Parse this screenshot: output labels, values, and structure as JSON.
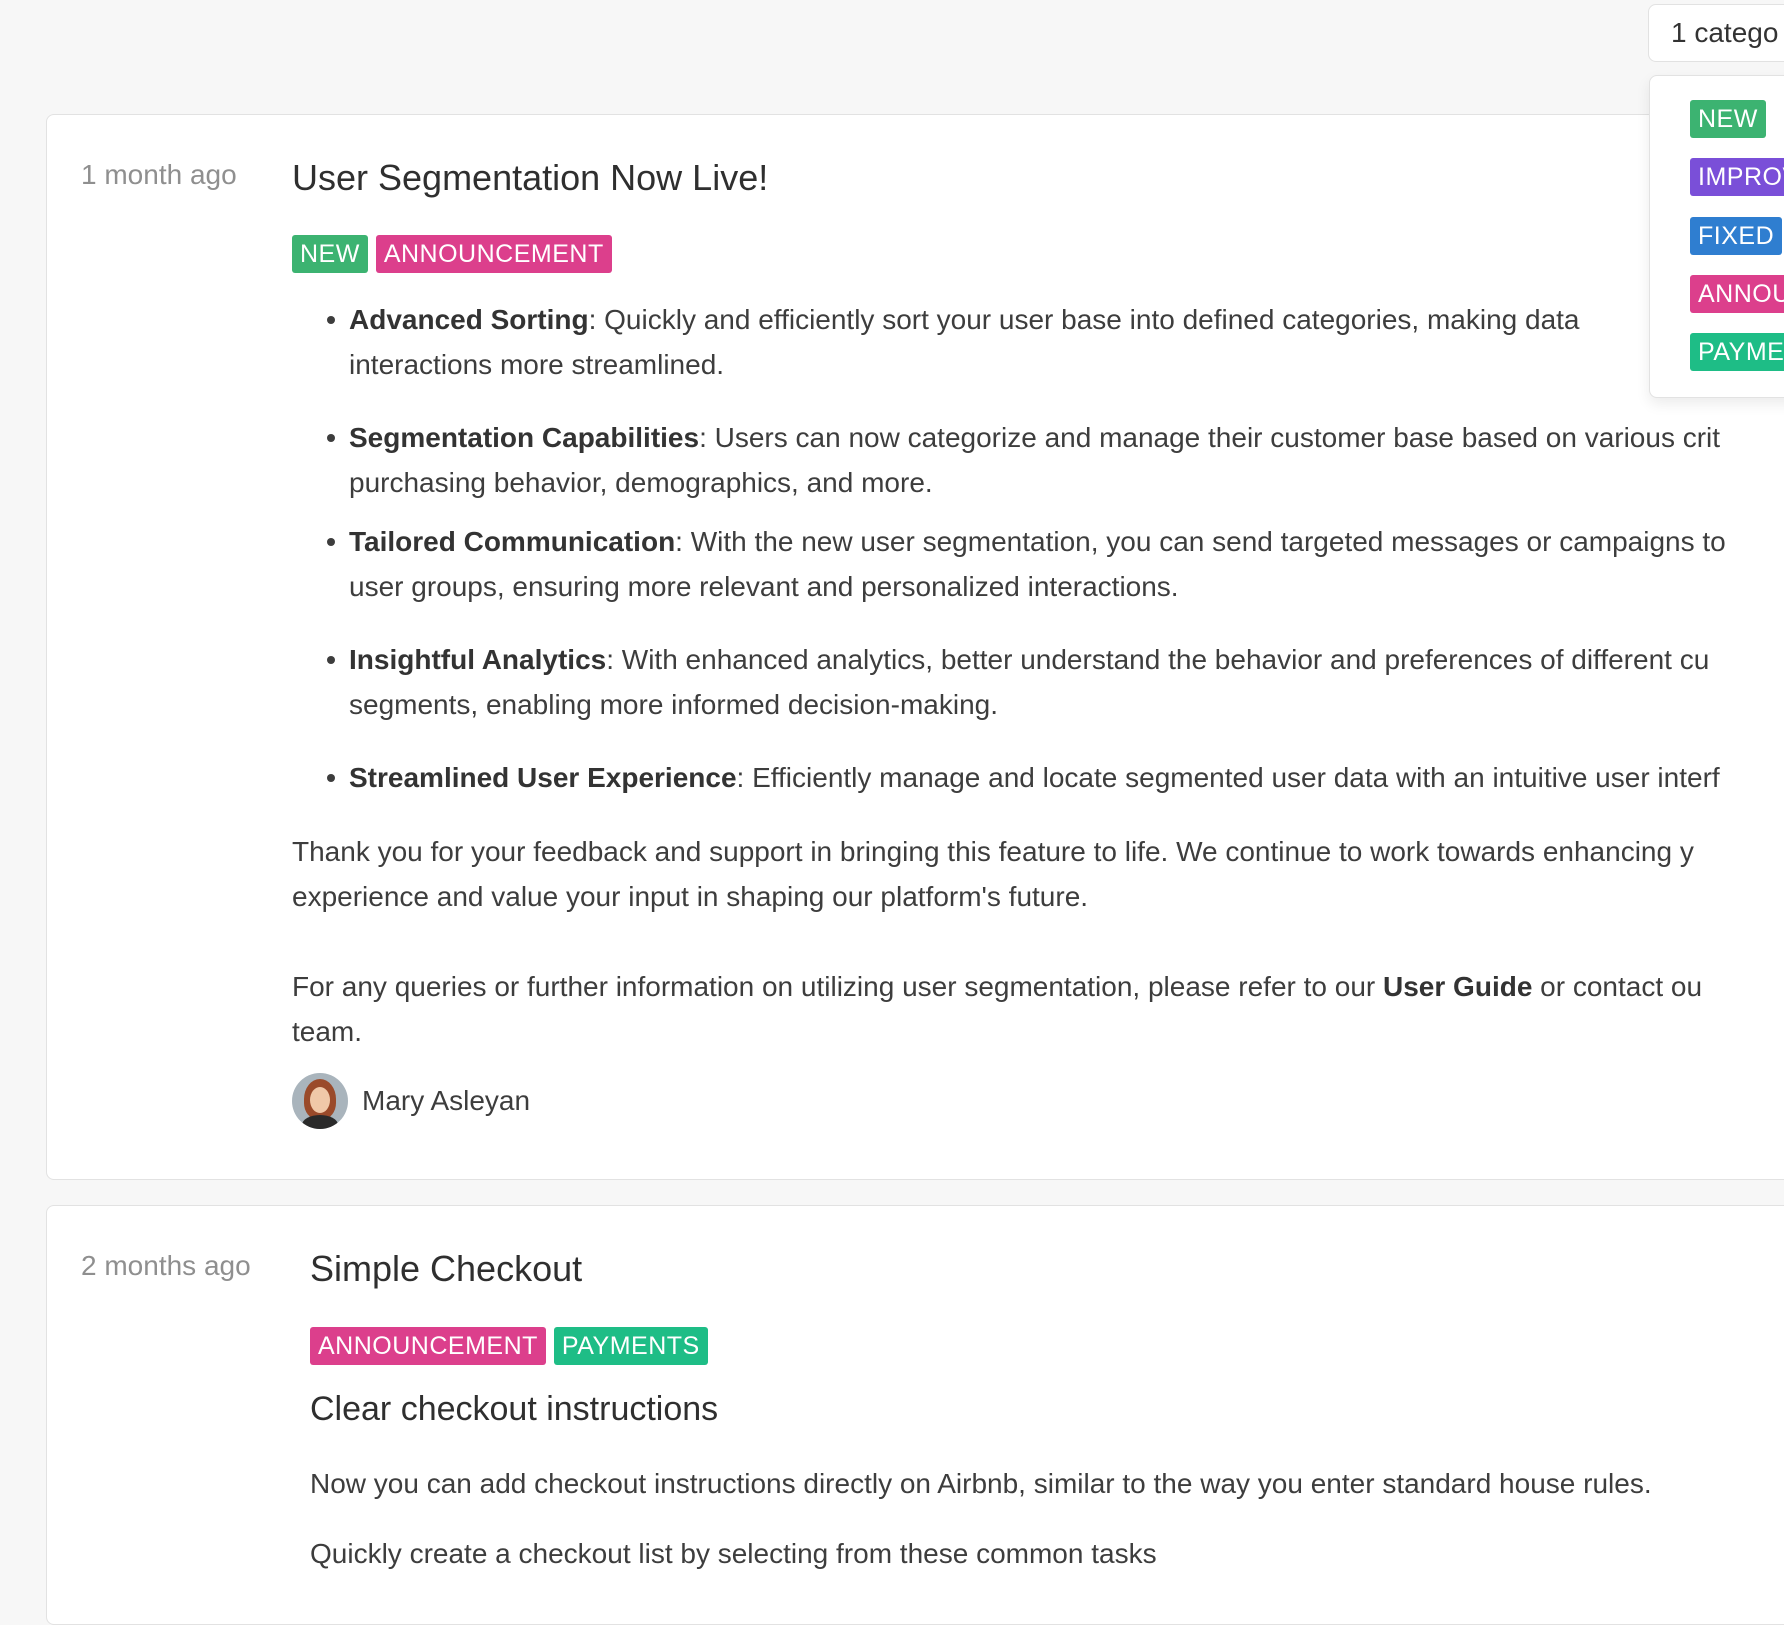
{
  "filter": {
    "label": "1 catego",
    "options": [
      {
        "label": "NEW",
        "color": "#3cb371"
      },
      {
        "label": "IMPROV",
        "color": "#7a4fd8"
      },
      {
        "label": "FIXED",
        "color": "#2f7ed0"
      },
      {
        "label": "ANNOU",
        "color": "#dc3f8c"
      },
      {
        "label": "PAYMEN",
        "color": "#1ebd86"
      }
    ]
  },
  "posts": [
    {
      "date": "1 month ago",
      "title": "User Segmentation Now Live!",
      "tags": [
        "NEW",
        "ANNOUNCEMENT"
      ],
      "bullets": [
        {
          "bold": "Advanced Sorting",
          "line1": ": Quickly and efficiently sort your user base into defined categories, making data",
          "line2": "interactions more streamlined."
        },
        {
          "bold": "Segmentation Capabilities",
          "line1": ": Users can now categorize and manage their customer base based on various crit",
          "line2": "purchasing behavior, demographics, and more."
        },
        {
          "bold": "Tailored Communication",
          "line1": ": With the new user segmentation, you can send targeted messages or campaigns to",
          "line2": "user groups, ensuring more relevant and personalized interactions."
        },
        {
          "bold": "Insightful Analytics",
          "line1": ": With enhanced analytics, better understand the behavior and preferences of different cu",
          "line2": "segments, enabling more informed decision-making."
        },
        {
          "bold": "Streamlined User Experience",
          "line1": ": Efficiently manage and locate segmented user data with an intuitive user interf",
          "line2": ""
        }
      ],
      "thanks_line1": "Thank you for your feedback and support in bringing this feature to life. We continue to work towards enhancing y",
      "thanks_line2": "experience and value your input in shaping our platform's future.",
      "query_prefix": "For any queries or further information on utilizing user segmentation, please refer to our ",
      "query_link": "User Guide",
      "query_suffix": " or contact ou",
      "query_line2": "team.",
      "author": "Mary Asleyan"
    },
    {
      "date": "2 months ago",
      "title": "Simple Checkout",
      "tags": [
        "ANNOUNCEMENT",
        "PAYMENTS"
      ],
      "subheading": "Clear checkout instructions",
      "paragraph": "Now you can add checkout instructions directly on Airbnb, similar to the way you enter standard house rules.",
      "cut_line": "Quickly create a checkout list by selecting from these common tasks"
    }
  ]
}
